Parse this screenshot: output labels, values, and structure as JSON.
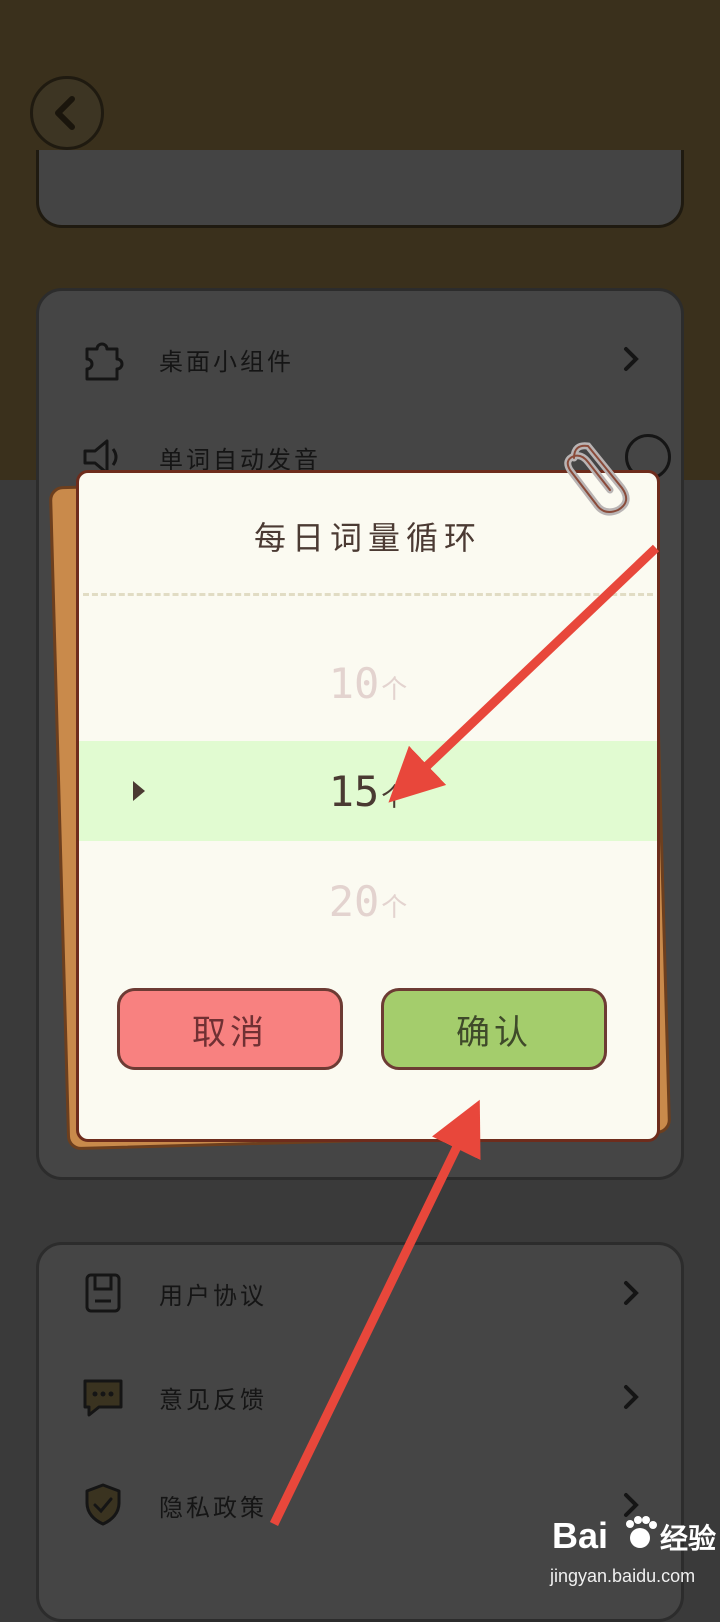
{
  "settings_list": {
    "widget_label": "桌面小组件",
    "auto_pronounce_label": "单词自动发音",
    "user_agreement_label": "用户协议",
    "feedback_label": "意见反馈",
    "privacy_label": "隐私政策"
  },
  "dialog": {
    "title": "每日词量循环",
    "options": [
      {
        "value": "10",
        "unit": "个",
        "selected": false
      },
      {
        "value": "15",
        "unit": "个",
        "selected": true
      },
      {
        "value": "20",
        "unit": "个",
        "selected": false
      }
    ],
    "cancel_label": "取消",
    "confirm_label": "确认"
  },
  "watermark": {
    "brand": "Bai",
    "brand_suffix": "经验",
    "url": "jingyan.baidu.com"
  },
  "colors": {
    "selected_row": "#e1fbd1",
    "cancel_button": "#f88180",
    "confirm_button": "#a4cd6c",
    "annotation_arrow": "#e8473b"
  },
  "icons": [
    "back-icon",
    "puzzle-icon",
    "speaker-icon",
    "document-icon",
    "chat-icon",
    "shield-icon",
    "chevron-right-icon",
    "paperclip-icon",
    "paw-icon"
  ]
}
